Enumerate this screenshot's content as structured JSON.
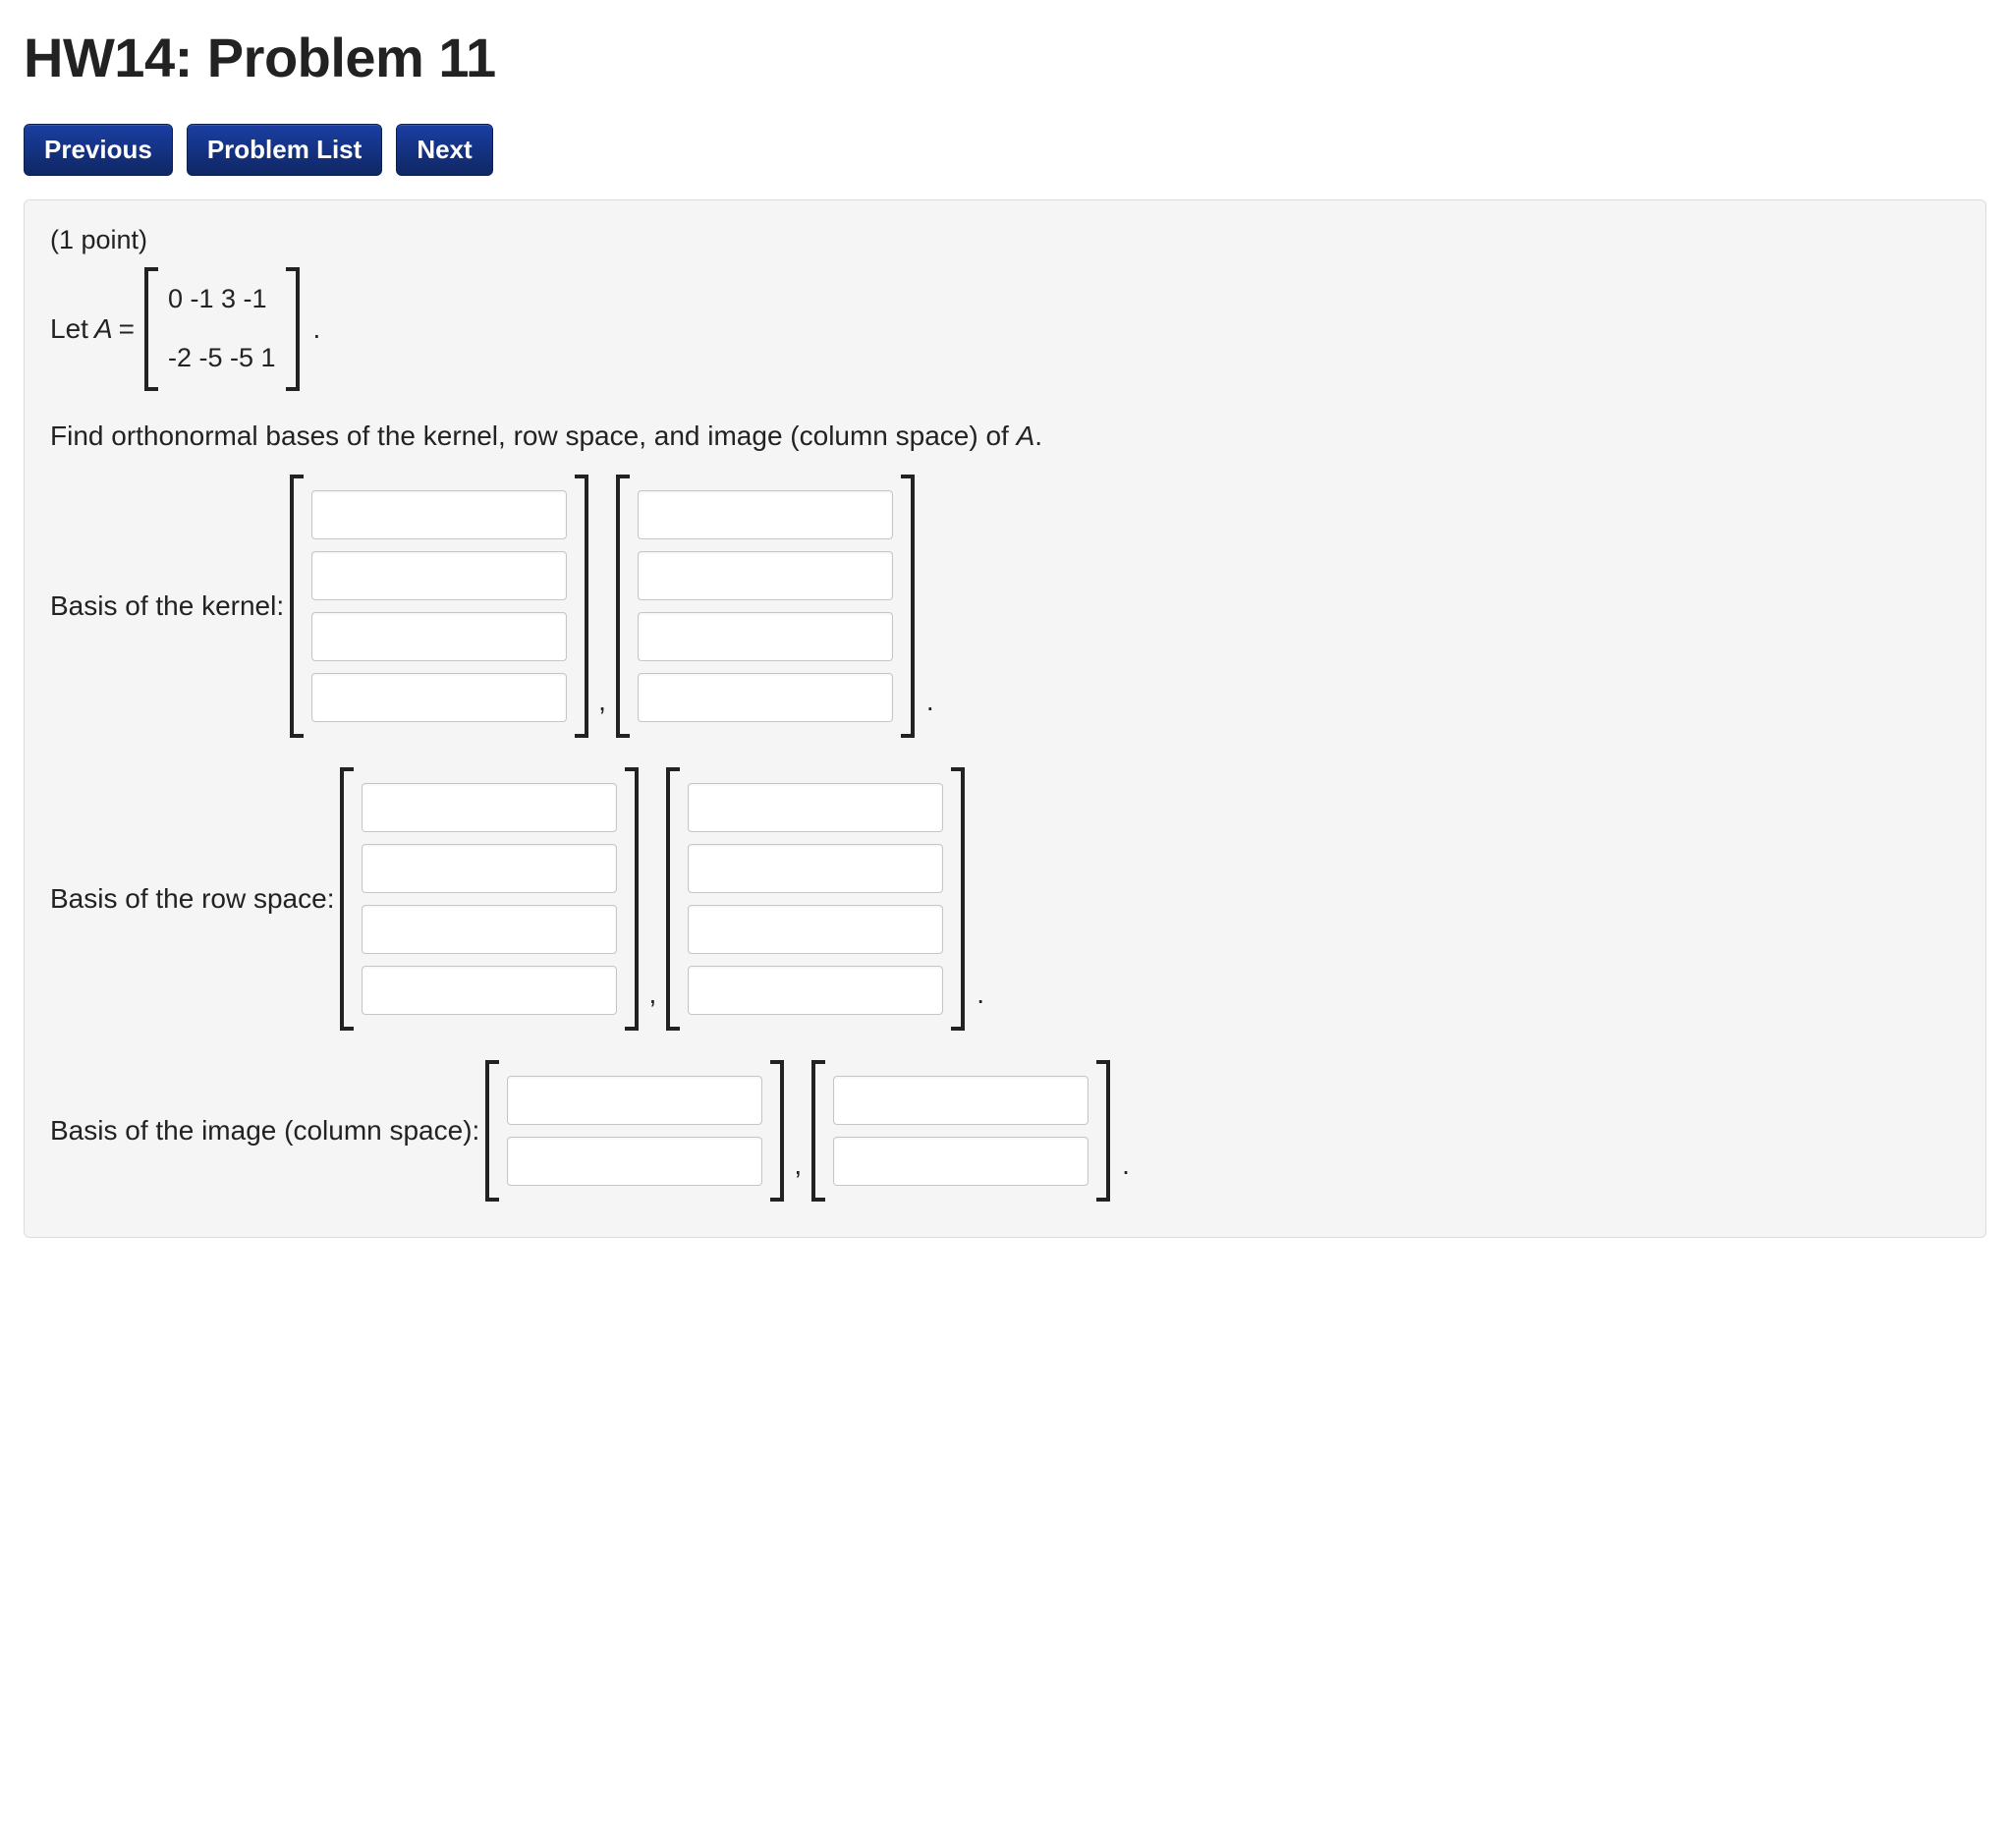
{
  "title": "HW14: Problem 11",
  "nav": {
    "previous": "Previous",
    "problem_list": "Problem List",
    "next": "Next"
  },
  "problem": {
    "points_text": "(1 point)",
    "let_prefix": "Let ",
    "let_var": "A",
    "let_equals": " = ",
    "matrix_rows": [
      "0 -1 3 -1",
      "-2 -5 -5 1"
    ],
    "prompt_prefix": "Find orthonormal bases of the kernel, row space, and image (column space) of ",
    "prompt_var": "A",
    "prompt_suffix": ".",
    "sections": {
      "kernel": {
        "label": "Basis of the kernel:",
        "vectors": 2,
        "components": 4
      },
      "rowspace": {
        "label": "Basis of the row space:",
        "vectors": 2,
        "components": 4
      },
      "image": {
        "label": "Basis of the image (column space):",
        "vectors": 2,
        "components": 2
      }
    },
    "separator": ",",
    "period": "."
  }
}
